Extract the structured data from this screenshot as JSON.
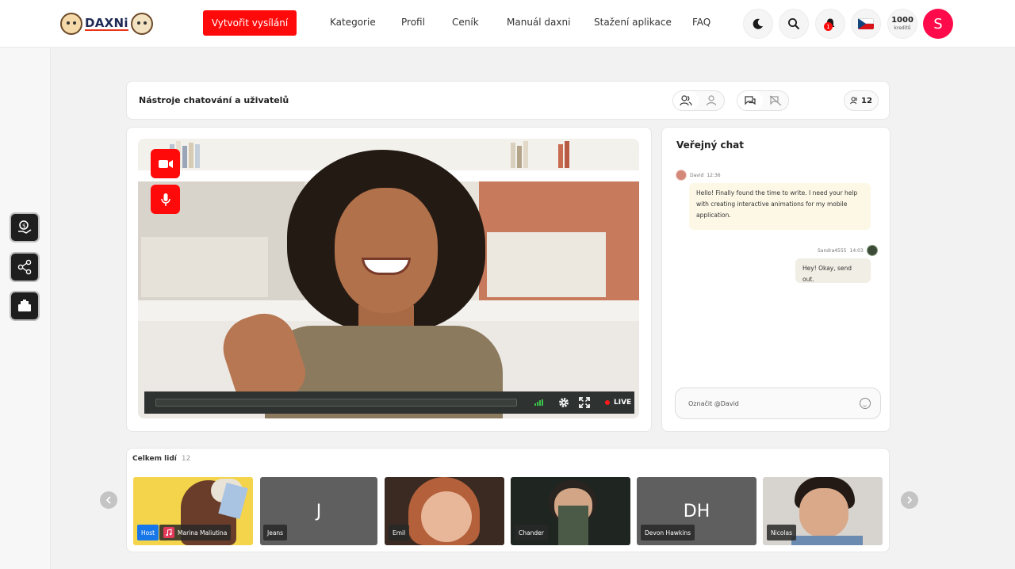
{
  "header": {
    "logo_text": "DAXNi",
    "create_button": "Vytvořit vysílání",
    "nav": [
      "Kategorie",
      "Profil",
      "Ceník",
      "Manuál daxni",
      "Stažení aplikace",
      "FAQ"
    ],
    "notifications_count": "1",
    "credits_value": "1000",
    "credits_label": "kreditů",
    "avatar_letter": "S",
    "brand_color": "#ff0a0a"
  },
  "sidebar": {
    "items": [
      "tip-icon",
      "share-icon",
      "gift-icon"
    ]
  },
  "tools": {
    "title": "Nástroje chatování a uživatelů",
    "user_count": "12"
  },
  "video": {
    "live_label": "LIVE",
    "icons": [
      "camera-icon",
      "microphone-icon",
      "settings-icon",
      "fullscreen-icon"
    ]
  },
  "chat": {
    "title": "Veřejný chat",
    "messages": [
      {
        "author": "David",
        "time": "12:36",
        "text": "Hello! Finally found the time to write. I need your help with creating interactive animations for my mobile application."
      },
      {
        "author": "Sandra4555",
        "time": "14:03",
        "text": "Hey! Okay, send out."
      }
    ],
    "input_value": "Označit @David"
  },
  "people": {
    "title": "Celkem lidí",
    "count": "12",
    "host_label": "Host",
    "tiles": [
      {
        "name": "Marina Maliutina",
        "initials": ""
      },
      {
        "name": "Jeans",
        "initials": "J"
      },
      {
        "name": "Emil",
        "initials": ""
      },
      {
        "name": "Chander",
        "initials": ""
      },
      {
        "name": "Devon Hawkins",
        "initials": "DH"
      },
      {
        "name": "Nicolas",
        "initials": ""
      }
    ]
  }
}
